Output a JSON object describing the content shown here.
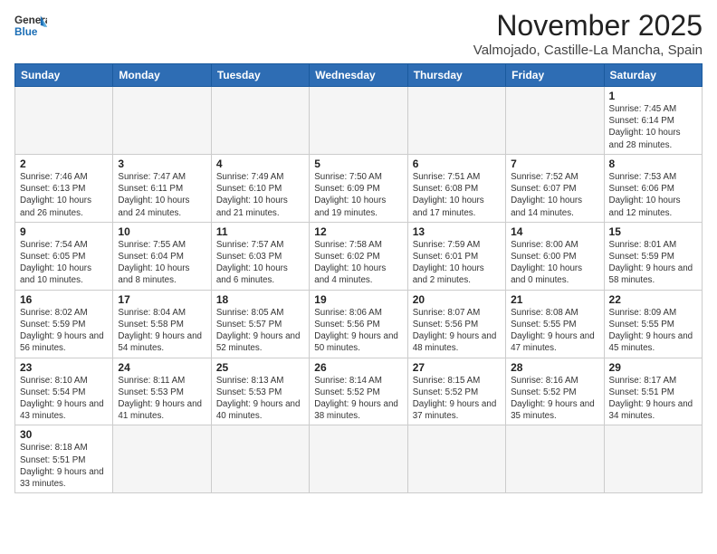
{
  "logo": {
    "line1": "General",
    "line2": "Blue"
  },
  "title": "November 2025",
  "location": "Valmojado, Castille-La Mancha, Spain",
  "weekdays": [
    "Sunday",
    "Monday",
    "Tuesday",
    "Wednesday",
    "Thursday",
    "Friday",
    "Saturday"
  ],
  "weeks": [
    [
      {
        "day": null
      },
      {
        "day": null
      },
      {
        "day": null
      },
      {
        "day": null
      },
      {
        "day": null
      },
      {
        "day": null
      },
      {
        "day": 1,
        "sunrise": "Sunrise: 7:45 AM",
        "sunset": "Sunset: 6:14 PM",
        "daylight": "Daylight: 10 hours and 28 minutes."
      }
    ],
    [
      {
        "day": 2,
        "sunrise": "Sunrise: 7:46 AM",
        "sunset": "Sunset: 6:13 PM",
        "daylight": "Daylight: 10 hours and 26 minutes."
      },
      {
        "day": 3,
        "sunrise": "Sunrise: 7:47 AM",
        "sunset": "Sunset: 6:11 PM",
        "daylight": "Daylight: 10 hours and 24 minutes."
      },
      {
        "day": 4,
        "sunrise": "Sunrise: 7:49 AM",
        "sunset": "Sunset: 6:10 PM",
        "daylight": "Daylight: 10 hours and 21 minutes."
      },
      {
        "day": 5,
        "sunrise": "Sunrise: 7:50 AM",
        "sunset": "Sunset: 6:09 PM",
        "daylight": "Daylight: 10 hours and 19 minutes."
      },
      {
        "day": 6,
        "sunrise": "Sunrise: 7:51 AM",
        "sunset": "Sunset: 6:08 PM",
        "daylight": "Daylight: 10 hours and 17 minutes."
      },
      {
        "day": 7,
        "sunrise": "Sunrise: 7:52 AM",
        "sunset": "Sunset: 6:07 PM",
        "daylight": "Daylight: 10 hours and 14 minutes."
      },
      {
        "day": 8,
        "sunrise": "Sunrise: 7:53 AM",
        "sunset": "Sunset: 6:06 PM",
        "daylight": "Daylight: 10 hours and 12 minutes."
      }
    ],
    [
      {
        "day": 9,
        "sunrise": "Sunrise: 7:54 AM",
        "sunset": "Sunset: 6:05 PM",
        "daylight": "Daylight: 10 hours and 10 minutes."
      },
      {
        "day": 10,
        "sunrise": "Sunrise: 7:55 AM",
        "sunset": "Sunset: 6:04 PM",
        "daylight": "Daylight: 10 hours and 8 minutes."
      },
      {
        "day": 11,
        "sunrise": "Sunrise: 7:57 AM",
        "sunset": "Sunset: 6:03 PM",
        "daylight": "Daylight: 10 hours and 6 minutes."
      },
      {
        "day": 12,
        "sunrise": "Sunrise: 7:58 AM",
        "sunset": "Sunset: 6:02 PM",
        "daylight": "Daylight: 10 hours and 4 minutes."
      },
      {
        "day": 13,
        "sunrise": "Sunrise: 7:59 AM",
        "sunset": "Sunset: 6:01 PM",
        "daylight": "Daylight: 10 hours and 2 minutes."
      },
      {
        "day": 14,
        "sunrise": "Sunrise: 8:00 AM",
        "sunset": "Sunset: 6:00 PM",
        "daylight": "Daylight: 10 hours and 0 minutes."
      },
      {
        "day": 15,
        "sunrise": "Sunrise: 8:01 AM",
        "sunset": "Sunset: 5:59 PM",
        "daylight": "Daylight: 9 hours and 58 minutes."
      }
    ],
    [
      {
        "day": 16,
        "sunrise": "Sunrise: 8:02 AM",
        "sunset": "Sunset: 5:59 PM",
        "daylight": "Daylight: 9 hours and 56 minutes."
      },
      {
        "day": 17,
        "sunrise": "Sunrise: 8:04 AM",
        "sunset": "Sunset: 5:58 PM",
        "daylight": "Daylight: 9 hours and 54 minutes."
      },
      {
        "day": 18,
        "sunrise": "Sunrise: 8:05 AM",
        "sunset": "Sunset: 5:57 PM",
        "daylight": "Daylight: 9 hours and 52 minutes."
      },
      {
        "day": 19,
        "sunrise": "Sunrise: 8:06 AM",
        "sunset": "Sunset: 5:56 PM",
        "daylight": "Daylight: 9 hours and 50 minutes."
      },
      {
        "day": 20,
        "sunrise": "Sunrise: 8:07 AM",
        "sunset": "Sunset: 5:56 PM",
        "daylight": "Daylight: 9 hours and 48 minutes."
      },
      {
        "day": 21,
        "sunrise": "Sunrise: 8:08 AM",
        "sunset": "Sunset: 5:55 PM",
        "daylight": "Daylight: 9 hours and 47 minutes."
      },
      {
        "day": 22,
        "sunrise": "Sunrise: 8:09 AM",
        "sunset": "Sunset: 5:55 PM",
        "daylight": "Daylight: 9 hours and 45 minutes."
      }
    ],
    [
      {
        "day": 23,
        "sunrise": "Sunrise: 8:10 AM",
        "sunset": "Sunset: 5:54 PM",
        "daylight": "Daylight: 9 hours and 43 minutes."
      },
      {
        "day": 24,
        "sunrise": "Sunrise: 8:11 AM",
        "sunset": "Sunset: 5:53 PM",
        "daylight": "Daylight: 9 hours and 41 minutes."
      },
      {
        "day": 25,
        "sunrise": "Sunrise: 8:13 AM",
        "sunset": "Sunset: 5:53 PM",
        "daylight": "Daylight: 9 hours and 40 minutes."
      },
      {
        "day": 26,
        "sunrise": "Sunrise: 8:14 AM",
        "sunset": "Sunset: 5:52 PM",
        "daylight": "Daylight: 9 hours and 38 minutes."
      },
      {
        "day": 27,
        "sunrise": "Sunrise: 8:15 AM",
        "sunset": "Sunset: 5:52 PM",
        "daylight": "Daylight: 9 hours and 37 minutes."
      },
      {
        "day": 28,
        "sunrise": "Sunrise: 8:16 AM",
        "sunset": "Sunset: 5:52 PM",
        "daylight": "Daylight: 9 hours and 35 minutes."
      },
      {
        "day": 29,
        "sunrise": "Sunrise: 8:17 AM",
        "sunset": "Sunset: 5:51 PM",
        "daylight": "Daylight: 9 hours and 34 minutes."
      }
    ],
    [
      {
        "day": 30,
        "sunrise": "Sunrise: 8:18 AM",
        "sunset": "Sunset: 5:51 PM",
        "daylight": "Daylight: 9 hours and 33 minutes."
      },
      {
        "day": null
      },
      {
        "day": null
      },
      {
        "day": null
      },
      {
        "day": null
      },
      {
        "day": null
      },
      {
        "day": null
      }
    ]
  ]
}
